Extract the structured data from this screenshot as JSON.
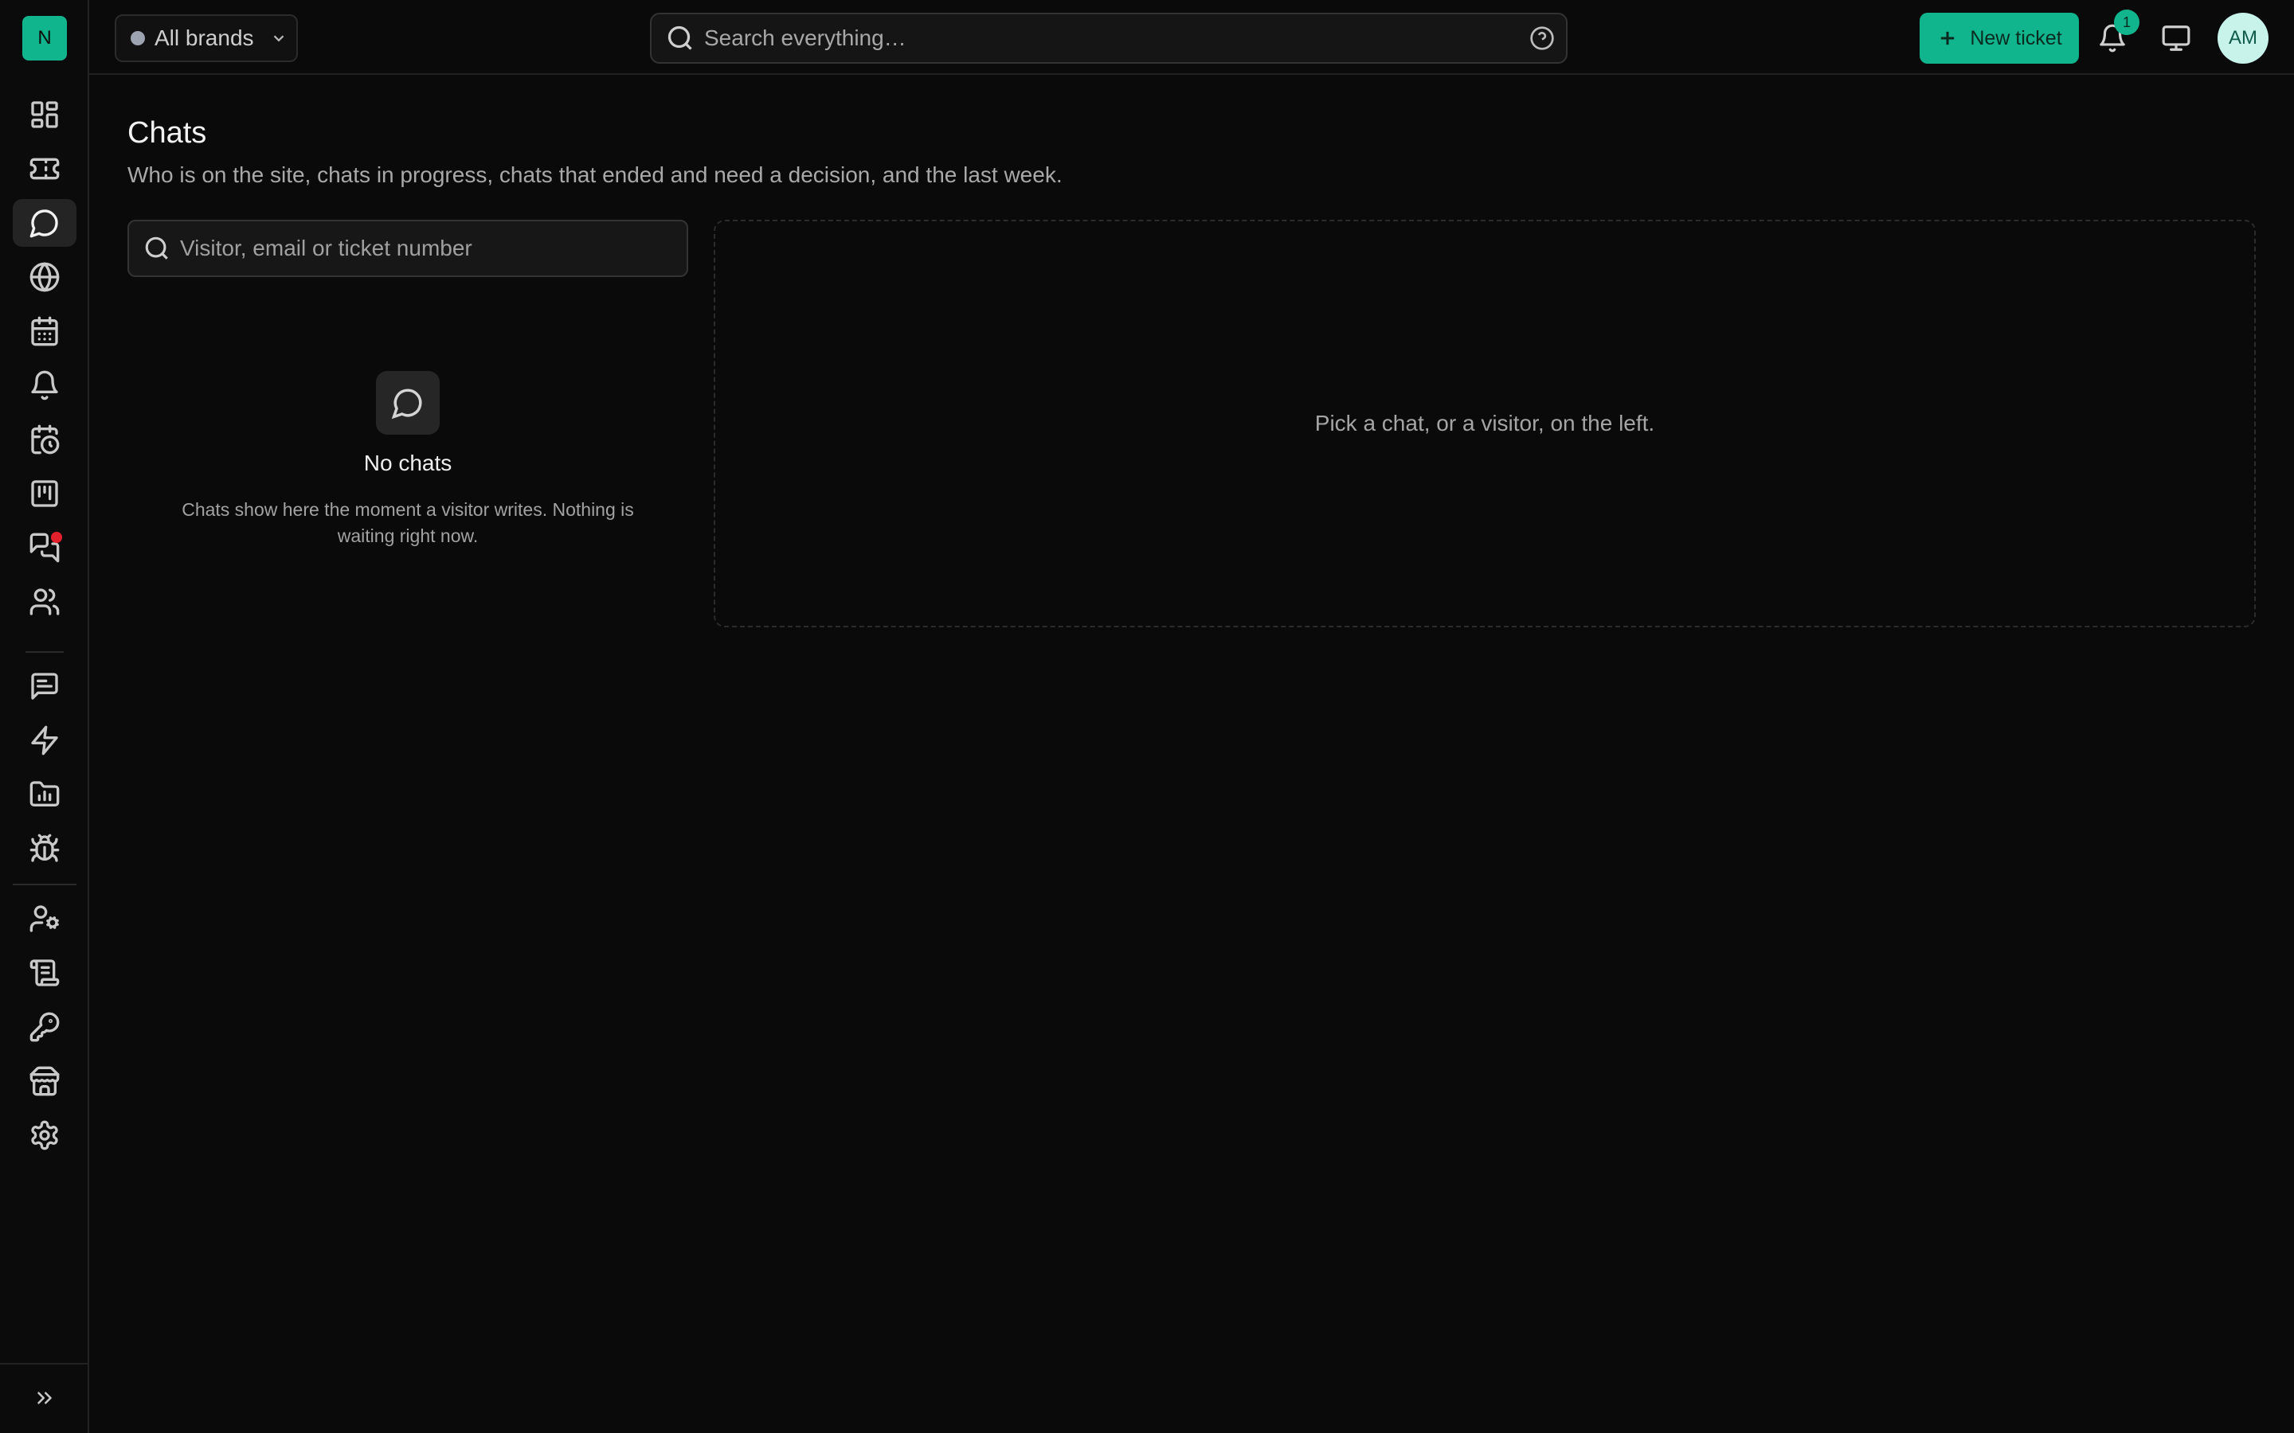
{
  "app": {
    "logo_letter": "N"
  },
  "sidebar": {
    "items": [
      {
        "name": "dashboard",
        "icon": "grid-icon"
      },
      {
        "name": "tickets",
        "icon": "ticket-icon"
      },
      {
        "name": "chats",
        "icon": "chat-bubble-icon",
        "active": true
      },
      {
        "name": "visitors",
        "icon": "globe-icon"
      },
      {
        "name": "calendar",
        "icon": "calendar-icon"
      },
      {
        "name": "alerts",
        "icon": "bell-icon"
      },
      {
        "name": "schedules",
        "icon": "calendar-clock-icon"
      },
      {
        "name": "board",
        "icon": "kanban-icon"
      },
      {
        "name": "conversations",
        "icon": "messages-icon",
        "has_badge": true
      },
      {
        "name": "customers",
        "icon": "users-icon"
      },
      {
        "name": "canned-replies",
        "icon": "message-square-text-icon"
      },
      {
        "name": "automations",
        "icon": "bolt-icon"
      },
      {
        "name": "reports",
        "icon": "folder-chart-icon"
      },
      {
        "name": "bugs",
        "icon": "bug-icon"
      },
      {
        "name": "agents",
        "icon": "user-cog-icon"
      },
      {
        "name": "logs",
        "icon": "scroll-icon"
      },
      {
        "name": "api-keys",
        "icon": "key-icon"
      },
      {
        "name": "store",
        "icon": "store-icon"
      },
      {
        "name": "settings",
        "icon": "gear-icon"
      }
    ],
    "expand_icon": "chevrons-right-icon"
  },
  "topbar": {
    "brand_select": "All brands",
    "search_placeholder": "Search everything…",
    "new_ticket_label": "New ticket",
    "notification_count": "1",
    "avatar_initials": "AM"
  },
  "page": {
    "title": "Chats",
    "subtitle": "Who is on the site, chats in progress, chats that ended and need a decision, and the last week.",
    "chat_search_placeholder": "Visitor, email or ticket number",
    "empty_title": "No chats",
    "empty_text": "Chats show here the moment a visitor writes. Nothing is waiting right now.",
    "detail_hint": "Pick a chat, or a visitor, on the left."
  },
  "colors": {
    "accent": "#10b58d",
    "background": "#0a0a0a",
    "badge_red": "#e5202d"
  }
}
